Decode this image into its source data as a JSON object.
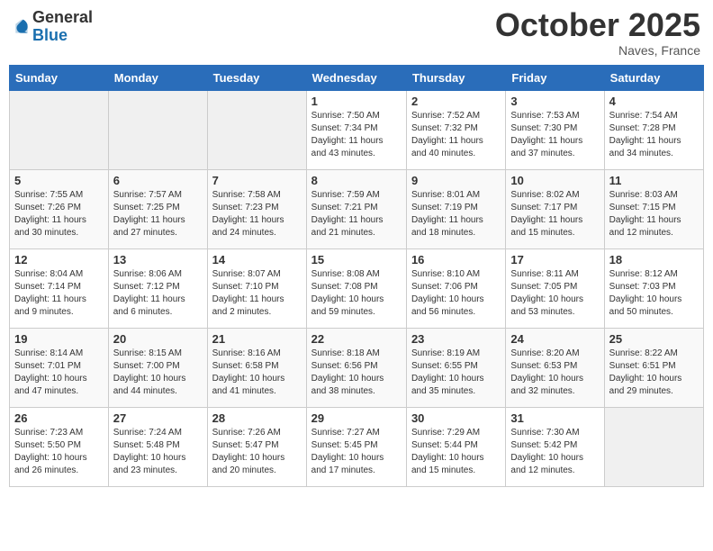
{
  "logo": {
    "general": "General",
    "blue": "Blue"
  },
  "title": {
    "month": "October 2025",
    "location": "Naves, France"
  },
  "weekdays": [
    "Sunday",
    "Monday",
    "Tuesday",
    "Wednesday",
    "Thursday",
    "Friday",
    "Saturday"
  ],
  "weeks": [
    [
      {
        "day": "",
        "info": ""
      },
      {
        "day": "",
        "info": ""
      },
      {
        "day": "",
        "info": ""
      },
      {
        "day": "1",
        "info": "Sunrise: 7:50 AM\nSunset: 7:34 PM\nDaylight: 11 hours\nand 43 minutes."
      },
      {
        "day": "2",
        "info": "Sunrise: 7:52 AM\nSunset: 7:32 PM\nDaylight: 11 hours\nand 40 minutes."
      },
      {
        "day": "3",
        "info": "Sunrise: 7:53 AM\nSunset: 7:30 PM\nDaylight: 11 hours\nand 37 minutes."
      },
      {
        "day": "4",
        "info": "Sunrise: 7:54 AM\nSunset: 7:28 PM\nDaylight: 11 hours\nand 34 minutes."
      }
    ],
    [
      {
        "day": "5",
        "info": "Sunrise: 7:55 AM\nSunset: 7:26 PM\nDaylight: 11 hours\nand 30 minutes."
      },
      {
        "day": "6",
        "info": "Sunrise: 7:57 AM\nSunset: 7:25 PM\nDaylight: 11 hours\nand 27 minutes."
      },
      {
        "day": "7",
        "info": "Sunrise: 7:58 AM\nSunset: 7:23 PM\nDaylight: 11 hours\nand 24 minutes."
      },
      {
        "day": "8",
        "info": "Sunrise: 7:59 AM\nSunset: 7:21 PM\nDaylight: 11 hours\nand 21 minutes."
      },
      {
        "day": "9",
        "info": "Sunrise: 8:01 AM\nSunset: 7:19 PM\nDaylight: 11 hours\nand 18 minutes."
      },
      {
        "day": "10",
        "info": "Sunrise: 8:02 AM\nSunset: 7:17 PM\nDaylight: 11 hours\nand 15 minutes."
      },
      {
        "day": "11",
        "info": "Sunrise: 8:03 AM\nSunset: 7:15 PM\nDaylight: 11 hours\nand 12 minutes."
      }
    ],
    [
      {
        "day": "12",
        "info": "Sunrise: 8:04 AM\nSunset: 7:14 PM\nDaylight: 11 hours\nand 9 minutes."
      },
      {
        "day": "13",
        "info": "Sunrise: 8:06 AM\nSunset: 7:12 PM\nDaylight: 11 hours\nand 6 minutes."
      },
      {
        "day": "14",
        "info": "Sunrise: 8:07 AM\nSunset: 7:10 PM\nDaylight: 11 hours\nand 2 minutes."
      },
      {
        "day": "15",
        "info": "Sunrise: 8:08 AM\nSunset: 7:08 PM\nDaylight: 10 hours\nand 59 minutes."
      },
      {
        "day": "16",
        "info": "Sunrise: 8:10 AM\nSunset: 7:06 PM\nDaylight: 10 hours\nand 56 minutes."
      },
      {
        "day": "17",
        "info": "Sunrise: 8:11 AM\nSunset: 7:05 PM\nDaylight: 10 hours\nand 53 minutes."
      },
      {
        "day": "18",
        "info": "Sunrise: 8:12 AM\nSunset: 7:03 PM\nDaylight: 10 hours\nand 50 minutes."
      }
    ],
    [
      {
        "day": "19",
        "info": "Sunrise: 8:14 AM\nSunset: 7:01 PM\nDaylight: 10 hours\nand 47 minutes."
      },
      {
        "day": "20",
        "info": "Sunrise: 8:15 AM\nSunset: 7:00 PM\nDaylight: 10 hours\nand 44 minutes."
      },
      {
        "day": "21",
        "info": "Sunrise: 8:16 AM\nSunset: 6:58 PM\nDaylight: 10 hours\nand 41 minutes."
      },
      {
        "day": "22",
        "info": "Sunrise: 8:18 AM\nSunset: 6:56 PM\nDaylight: 10 hours\nand 38 minutes."
      },
      {
        "day": "23",
        "info": "Sunrise: 8:19 AM\nSunset: 6:55 PM\nDaylight: 10 hours\nand 35 minutes."
      },
      {
        "day": "24",
        "info": "Sunrise: 8:20 AM\nSunset: 6:53 PM\nDaylight: 10 hours\nand 32 minutes."
      },
      {
        "day": "25",
        "info": "Sunrise: 8:22 AM\nSunset: 6:51 PM\nDaylight: 10 hours\nand 29 minutes."
      }
    ],
    [
      {
        "day": "26",
        "info": "Sunrise: 7:23 AM\nSunset: 5:50 PM\nDaylight: 10 hours\nand 26 minutes."
      },
      {
        "day": "27",
        "info": "Sunrise: 7:24 AM\nSunset: 5:48 PM\nDaylight: 10 hours\nand 23 minutes."
      },
      {
        "day": "28",
        "info": "Sunrise: 7:26 AM\nSunset: 5:47 PM\nDaylight: 10 hours\nand 20 minutes."
      },
      {
        "day": "29",
        "info": "Sunrise: 7:27 AM\nSunset: 5:45 PM\nDaylight: 10 hours\nand 17 minutes."
      },
      {
        "day": "30",
        "info": "Sunrise: 7:29 AM\nSunset: 5:44 PM\nDaylight: 10 hours\nand 15 minutes."
      },
      {
        "day": "31",
        "info": "Sunrise: 7:30 AM\nSunset: 5:42 PM\nDaylight: 10 hours\nand 12 minutes."
      },
      {
        "day": "",
        "info": ""
      }
    ]
  ]
}
